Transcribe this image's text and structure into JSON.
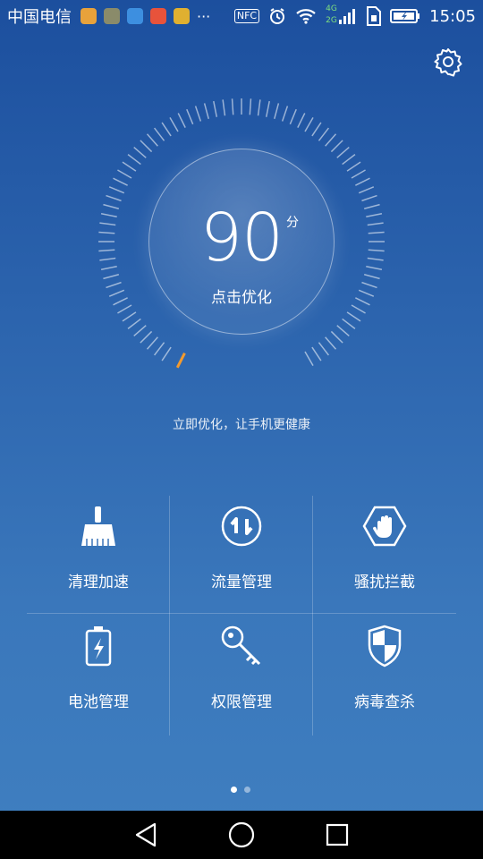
{
  "status_bar": {
    "carrier": "中国电信",
    "time": "15:05",
    "network_4g": "4G",
    "network_2g": "2G",
    "nfc": "NFC",
    "more": "···"
  },
  "score": {
    "value": "90",
    "unit": "分",
    "action": "点击优化"
  },
  "tagline": "立即优化，让手机更健康",
  "features": [
    {
      "label": "清理加速",
      "icon": "broom-icon"
    },
    {
      "label": "流量管理",
      "icon": "traffic-arrows-icon"
    },
    {
      "label": "骚扰拦截",
      "icon": "hand-block-icon"
    },
    {
      "label": "电池管理",
      "icon": "battery-icon"
    },
    {
      "label": "权限管理",
      "icon": "key-icon"
    },
    {
      "label": "病毒查杀",
      "icon": "shield-icon"
    }
  ],
  "page_indicator": {
    "count": 2,
    "active": 1
  },
  "colors": {
    "accent_tick": "#f39a2e",
    "bg_top": "#1c4f9e",
    "bg_bottom": "#3f7fc0"
  }
}
